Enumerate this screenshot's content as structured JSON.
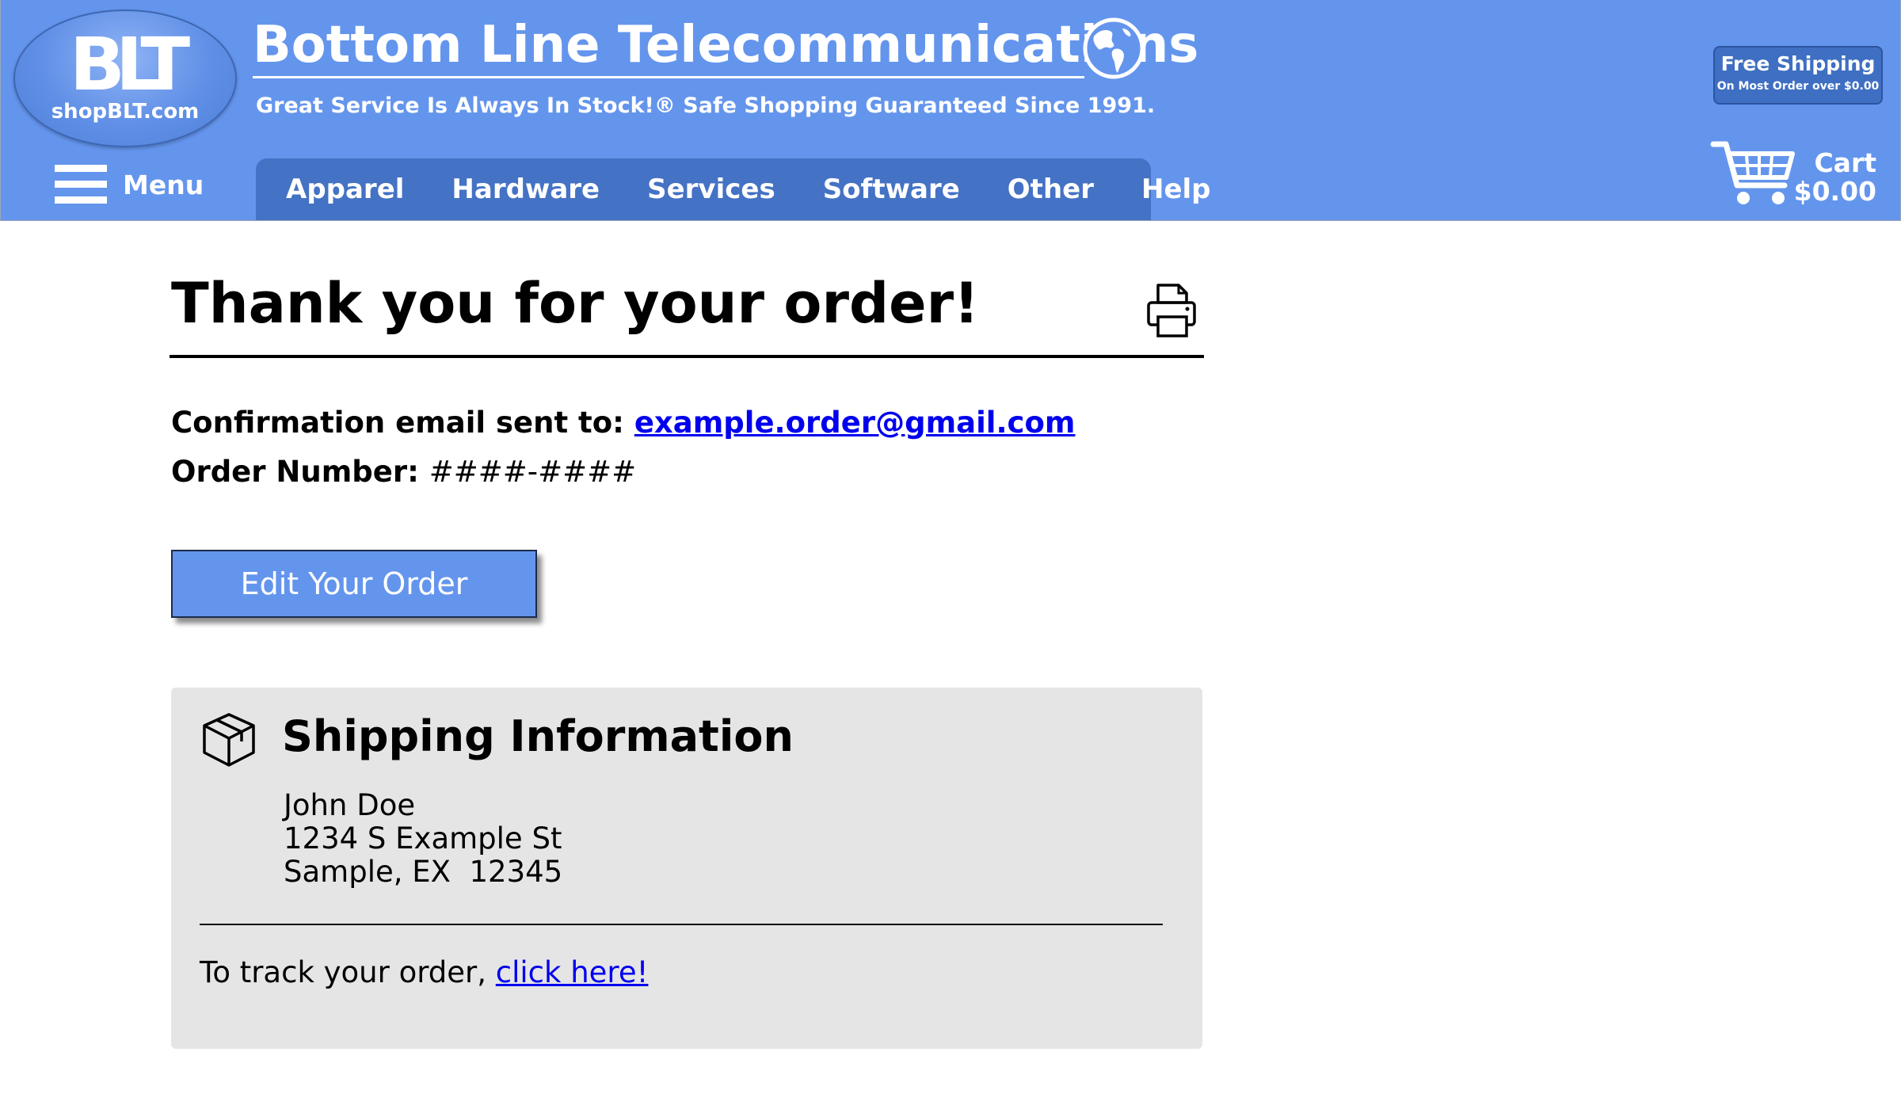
{
  "header": {
    "logo_letters": "BLT",
    "logo_domain": "shopBLT.com",
    "brand_title": "Bottom Line Telecommunications",
    "tagline": "Great Service Is Always In Stock!® Safe Shopping Guaranteed Since 1991.",
    "menu_label": "Menu",
    "nav": [
      {
        "label": "Apparel"
      },
      {
        "label": "Hardware"
      },
      {
        "label": "Services"
      },
      {
        "label": "Software"
      },
      {
        "label": "Other"
      },
      {
        "label": "Help"
      }
    ],
    "free_shipping": {
      "title": "Free Shipping",
      "subtitle": "On Most Order over $0.00"
    },
    "cart": {
      "label": "Cart",
      "total": "$0.00"
    },
    "colors": {
      "header_bg": "#6495ed",
      "nav_bg": "#4472c4"
    }
  },
  "main": {
    "title": "Thank you for your order!",
    "confirmation_label": "Confirmation email sent to:",
    "confirmation_email": "example.order@gmail.com",
    "order_number_label": "Order Number:",
    "order_number_value": "####-####",
    "edit_button": "Edit Your Order"
  },
  "shipping": {
    "title": "Shipping Information",
    "address": [
      "John Doe",
      "1234 S Example St",
      "Sample, EX  12345"
    ],
    "track_text": "To track your order,",
    "track_link": "click here!"
  }
}
